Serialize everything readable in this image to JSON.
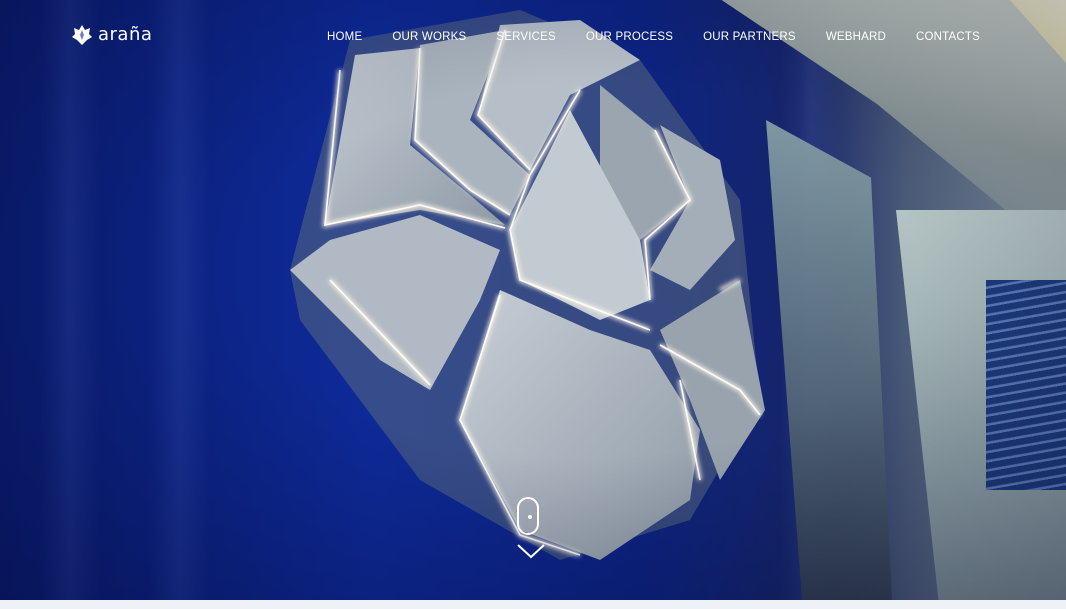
{
  "brand": {
    "name": "arañа",
    "logo_icon": "lotus-icon"
  },
  "nav": {
    "items": [
      {
        "label": "HOME"
      },
      {
        "label": "OUR WORKS"
      },
      {
        "label": "SERVICES"
      },
      {
        "label": "OUR PROCESS"
      },
      {
        "label": "OUR PARTNERS"
      },
      {
        "label": "WEBHARD"
      },
      {
        "label": "CONTACTS"
      }
    ]
  },
  "hero": {
    "scroll_icon": "mouse-scroll-icon",
    "arrow_icon": "chevron-down-icon"
  },
  "colors": {
    "nav_text": "#ffffff",
    "wall_blue": "#0e2a98",
    "page_bg": "#eef1f5"
  }
}
